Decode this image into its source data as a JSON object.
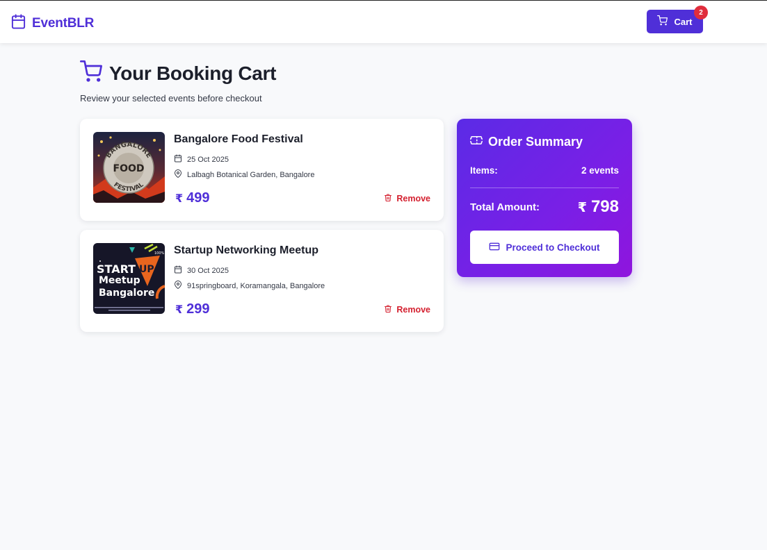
{
  "app": {
    "name": "EventBLR"
  },
  "nav": {
    "cart_label": "Cart",
    "cart_count": "2"
  },
  "header": {
    "title": "Your Booking Cart",
    "subtitle": "Review your selected events before checkout"
  },
  "cart_items": [
    {
      "name": "Bangalore Food Festival",
      "date": "25 Oct 2025",
      "location": "Lalbagh Botanical Garden, Bangalore",
      "currency": "₹",
      "price": "499",
      "remove_label": "Remove",
      "image_text": {
        "arc_top": "BANGALORE",
        "center": "FOOD",
        "arc_bottom": "FESTIVAL"
      }
    },
    {
      "name": "Startup Networking Meetup",
      "date": "30 Oct 2025",
      "location": "91springboard, Koramangala, Bangalore",
      "currency": "₹",
      "price": "299",
      "remove_label": "Remove",
      "image_text": {
        "line1": "START",
        "line1b": "UP",
        "line2": "Meetup",
        "line3": "Bangalore",
        "small": "100%"
      }
    }
  ],
  "summary": {
    "title": "Order Summary",
    "items_label": "Items:",
    "items_value": "2 events",
    "total_label": "Total Amount:",
    "currency": "₹",
    "total_value": "798",
    "checkout_label": "Proceed to Checkout"
  },
  "colors": {
    "brand": "#4f2fd8",
    "danger": "#d4202f",
    "badge": "#e02d3c",
    "summary_gradient_start": "#5b2be6",
    "summary_gradient_end": "#8f15dd"
  },
  "icons": {
    "brand": "calendar-icon",
    "cart": "cart-icon",
    "date": "calendar-icon",
    "location": "map-pin-icon",
    "remove": "trash-icon",
    "summary": "ticket-icon",
    "checkout": "credit-card-icon"
  }
}
